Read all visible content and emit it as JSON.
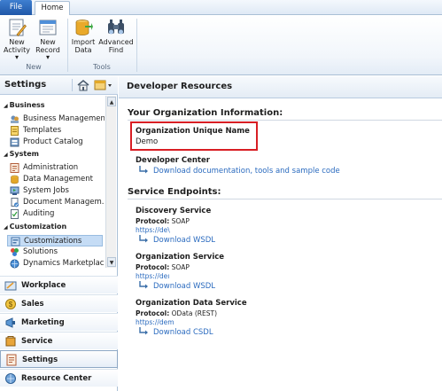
{
  "ribbon": {
    "tabs": [
      "File",
      "Home"
    ],
    "buttons": {
      "new_activity": [
        "New",
        "Activity ▾"
      ],
      "new_record": [
        "New",
        "Record ▾"
      ],
      "import_data": [
        "Import",
        "Data"
      ],
      "advanced_find": [
        "Advanced",
        "Find"
      ]
    },
    "groups": [
      "New",
      "Tools"
    ]
  },
  "leftnav": {
    "title": "Settings",
    "groups": [
      {
        "label": "Business",
        "items": [
          "Business Management",
          "Templates",
          "Product Catalog"
        ]
      },
      {
        "label": "System",
        "items": [
          "Administration",
          "Data Management",
          "System Jobs",
          "Document Managem...",
          "Auditing"
        ]
      },
      {
        "label": "Customization",
        "items": [
          "Customizations",
          "Solutions",
          "Dynamics Marketplace"
        ]
      }
    ],
    "selected_item": "Customizations",
    "areas": [
      "Workplace",
      "Sales",
      "Marketing",
      "Service",
      "Settings",
      "Resource Center"
    ],
    "selected_area": "Settings"
  },
  "content": {
    "header": "Developer Resources",
    "org_section": "Your Organization Information:",
    "org_unique_label": "Organization Unique Name",
    "org_unique_value": "Demo",
    "dev_center_label": "Developer Center",
    "dev_center_link": "Download documentation, tools and sample code",
    "endpoints_section": "Service Endpoints:",
    "services": [
      {
        "name": "Discovery Service",
        "protocol_label": "Protocol:",
        "protocol": "SOAP",
        "url": "https://de\\",
        "link": "Download WSDL"
      },
      {
        "name": "Organization Service",
        "protocol_label": "Protocol:",
        "protocol": "SOAP",
        "url": "https://deı",
        "link": "Download WSDL"
      },
      {
        "name": "Organization Data Service",
        "protocol_label": "Protocol:",
        "protocol": "OData (REST)",
        "url": "https://dem",
        "link": "Download CSDL"
      }
    ]
  },
  "colors": {
    "highlight": "#d81e24",
    "link": "#2b6bbf",
    "file_tab": "#2a68b8"
  },
  "icons": [
    "new-activity-icon",
    "new-record-icon",
    "import-data-icon",
    "advanced-find-icon",
    "home-icon",
    "menu-icon",
    "link-arrow-icon"
  ]
}
